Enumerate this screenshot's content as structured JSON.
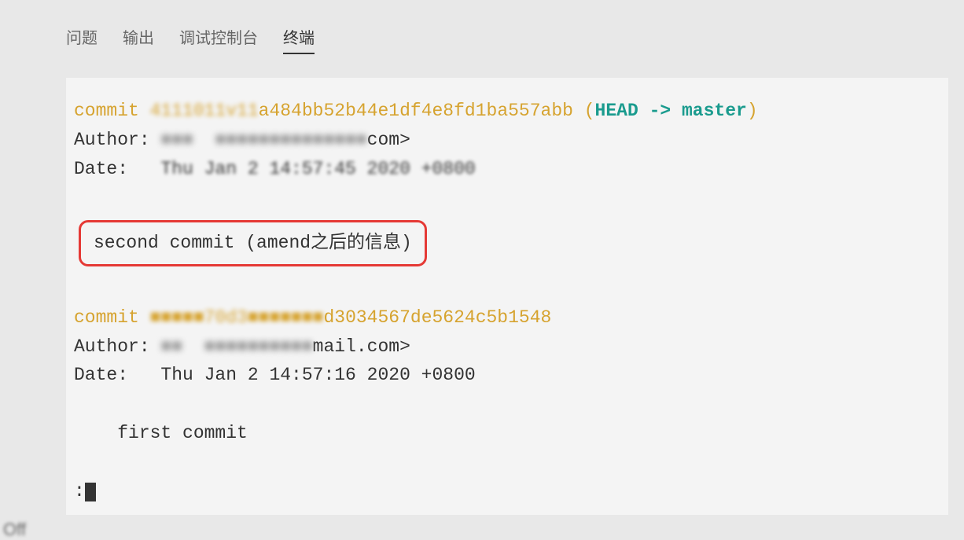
{
  "tabs": {
    "problems": "问题",
    "output": "输出",
    "debug_console": "调试控制台",
    "terminal": "终端"
  },
  "gitlog": {
    "commits": [
      {
        "commit_label": "commit",
        "hash_blur_prefix": "4111011v11",
        "hash_visible": "a484bb52b44e1df4e8fd1ba557abb",
        "paren_open": " (",
        "head": "HEAD",
        "arrow": " -> ",
        "branch": "master",
        "paren_close": ")",
        "author_label": "Author:",
        "author_blur": " ■■■  ■■■■■■■■■■■■■■",
        "author_suffix": "com>",
        "date_label": "Date:",
        "date_blur": "   Thu Jan 2 14:57:45 2020 +0800",
        "message": "second commit (amend之后的信息)"
      },
      {
        "commit_label": "commit",
        "hash_blur_prefix": " ■■■■■70d3■■■■■■■",
        "hash_visible": "d3034567de5624c5b1548",
        "author_label": "Author:",
        "author_blur": " ■■  ■■■■■■■■■■",
        "author_suffix": "mail.com>",
        "date_label": "Date:",
        "date_value": "   Thu Jan 2 14:57:16 2020 +0800",
        "message": "    first commit"
      }
    ],
    "prompt": ":",
    "cursor": "█"
  },
  "bottom": "    Off"
}
